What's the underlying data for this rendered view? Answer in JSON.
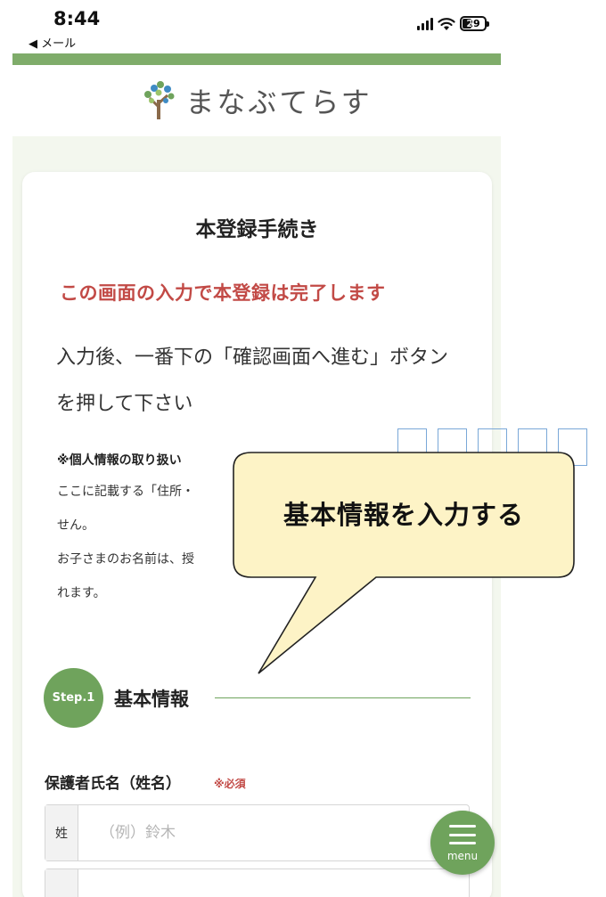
{
  "status_bar": {
    "time": "8:44",
    "back_label": "◀ メール",
    "battery": "29"
  },
  "header": {
    "logo_text": "まなぶてらす",
    "logo_icon": "tree-icon"
  },
  "card": {
    "title": "本登録手続き",
    "notice": "この画面の入力で本登録は完了します",
    "instruction": "入力後、一番下の「確認画面へ進む」ボタンを押して下さい",
    "privacy_title": "※個人情報の取り扱い",
    "privacy_lines": [
      "ここに記載する「住所・",
      "せん。",
      "お子さまのお名前は、授",
      "れます。"
    ]
  },
  "step": {
    "badge": "Step.1",
    "title": "基本情報"
  },
  "form": {
    "guardian_label": "保護者氏名（姓名）",
    "required_label": "※必須",
    "last_name_prefix": "姓",
    "last_name_placeholder": "（例）鈴木",
    "last_name_value": ""
  },
  "menu": {
    "label": "menu",
    "icon": "hamburger-icon"
  },
  "callout": {
    "text": "基本情報を入力する"
  },
  "colors": {
    "brand_green": "#6fa35c",
    "bar_green": "#7fac6a",
    "notice_red": "#c24a46",
    "callout_fill": "#fdf3c6"
  }
}
